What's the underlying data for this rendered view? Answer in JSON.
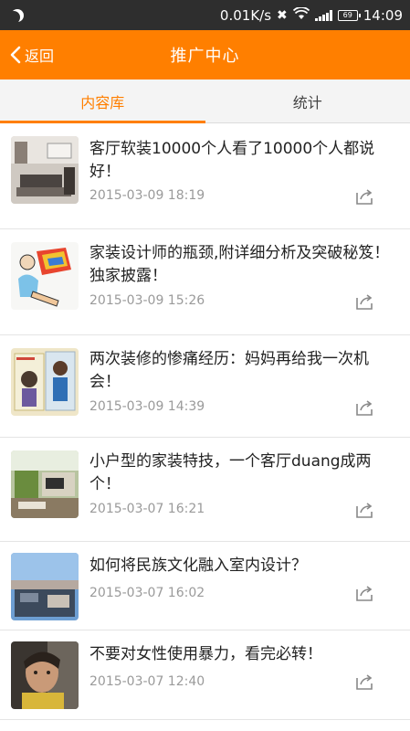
{
  "status": {
    "speed": "0.01K/s",
    "battery": "69",
    "time": "14:09"
  },
  "header": {
    "back_label": "返回",
    "title": "推广中心"
  },
  "tabs": [
    {
      "label": "内容库",
      "active": true
    },
    {
      "label": "统计",
      "active": false
    }
  ],
  "articles": [
    {
      "title": "客厅软装10000个人看了10000个人都说好！",
      "date": "2015-03-09 18:19"
    },
    {
      "title": "家装设计师的瓶颈,附详细分析及突破秘笈！独家披露！",
      "date": "2015-03-09 15:26"
    },
    {
      "title": "两次装修的惨痛经历：妈妈再给我一次机会！",
      "date": "2015-03-09 14:39"
    },
    {
      "title": "小户型的家装特技，一个客厅duang成两个！",
      "date": "2015-03-07 16:21"
    },
    {
      "title": "如何将民族文化融入室内设计？",
      "date": "2015-03-07 16:02"
    },
    {
      "title": "不要对女性使用暴力，看完必转！",
      "date": "2015-03-07 12:40"
    }
  ],
  "colors": {
    "accent": "#ff7f00",
    "statusbar": "#2e2e2e"
  }
}
